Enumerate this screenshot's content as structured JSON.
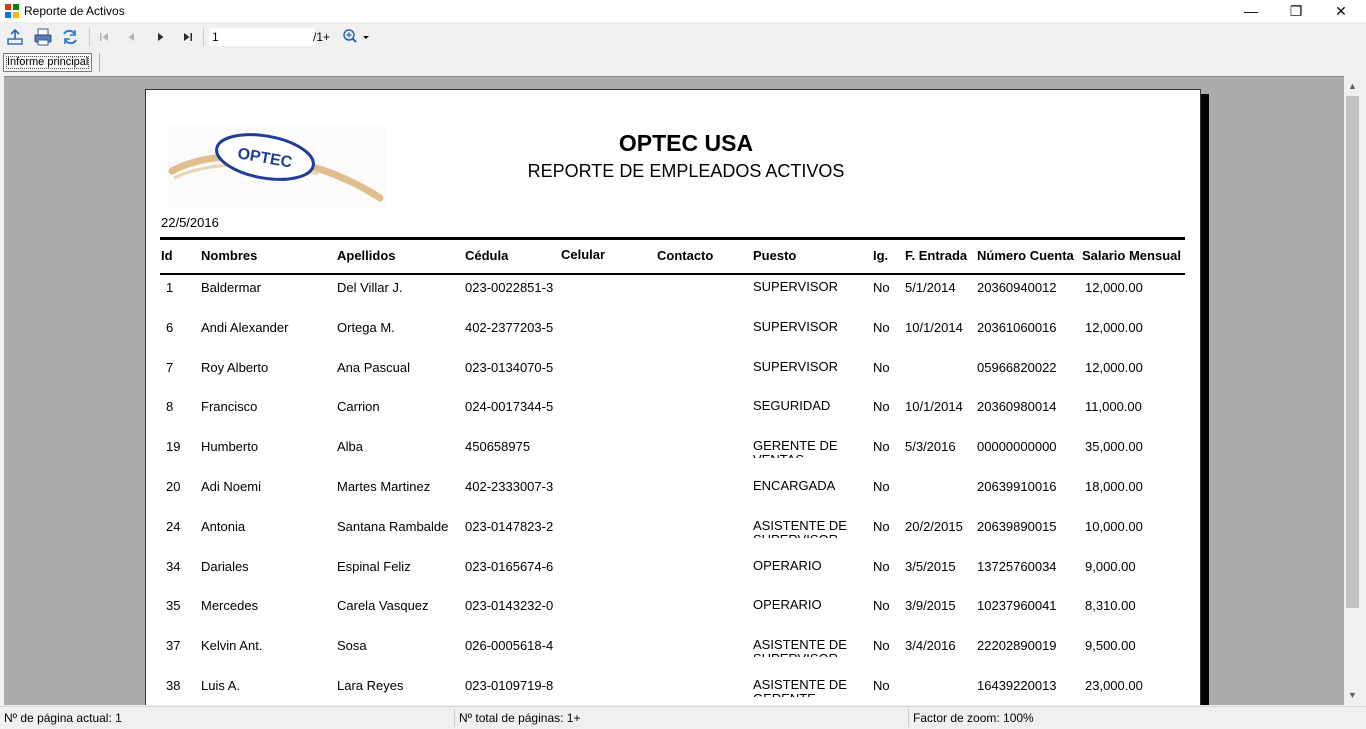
{
  "window": {
    "title": "Reporte de Activos",
    "minimize_glyph": "—",
    "maximize_glyph": "❐",
    "close_glyph": "✕"
  },
  "toolbar": {
    "page_value": "1",
    "page_total": "/1+",
    "icons": [
      "export-icon",
      "print-icon",
      "refresh-icon",
      "first-page-icon",
      "prev-page-icon",
      "next-page-icon",
      "last-page-icon",
      "zoom-icon"
    ]
  },
  "tabs": [
    "Informe principal"
  ],
  "report": {
    "logo_text": "OPTEC",
    "company": "OPTEC USA",
    "title": "REPORTE DE EMPLEADOS ACTIVOS",
    "date": "22/5/2016",
    "columns": [
      "Id",
      "Nombres",
      "Apellidos",
      "Cédula",
      "Celular",
      "Contacto",
      "Puesto",
      "Ig.",
      "F. Entrada",
      "Número Cuenta",
      "Salario Mensual"
    ],
    "rows": [
      {
        "id": "1",
        "nombres": "Baldermar",
        "apellidos": "Del Villar J.",
        "cedula": "023-0022851-3",
        "celular": "",
        "contacto": "",
        "puesto": "SUPERVISOR",
        "ig": "No",
        "entrada": "5/1/2014",
        "cuenta": "20360940012",
        "salario": "12,000.00"
      },
      {
        "id": "6",
        "nombres": "Andi Alexander",
        "apellidos": "Ortega M.",
        "cedula": "402-2377203-5",
        "celular": "",
        "contacto": "",
        "puesto": "SUPERVISOR",
        "ig": "No",
        "entrada": "10/1/2014",
        "cuenta": "20361060016",
        "salario": "12,000.00"
      },
      {
        "id": "7",
        "nombres": "Roy Alberto",
        "apellidos": "Ana Pascual",
        "cedula": "023-0134070-5",
        "celular": "",
        "contacto": "",
        "puesto": "SUPERVISOR",
        "ig": "No",
        "entrada": "",
        "cuenta": "05966820022",
        "salario": "12,000.00"
      },
      {
        "id": "8",
        "nombres": "Francisco",
        "apellidos": "Carrion",
        "cedula": "024-0017344-5",
        "celular": "",
        "contacto": "",
        "puesto": "SEGURIDAD",
        "ig": "No",
        "entrada": "10/1/2014",
        "cuenta": "20360980014",
        "salario": "11,000.00"
      },
      {
        "id": "19",
        "nombres": "Humberto",
        "apellidos": "Alba",
        "cedula": "450658975",
        "celular": "",
        "contacto": "",
        "puesto": "GERENTE DE VENTAS",
        "ig": "No",
        "entrada": "5/3/2016",
        "cuenta": "00000000000",
        "salario": "35,000.00"
      },
      {
        "id": "20",
        "nombres": "Adi Noemi",
        "apellidos": "Martes Martinez",
        "cedula": "402-2333007-3",
        "celular": "",
        "contacto": "",
        "puesto": "ENCARGADA",
        "ig": "No",
        "entrada": "",
        "cuenta": "20639910016",
        "salario": "18,000.00"
      },
      {
        "id": "24",
        "nombres": "Antonia",
        "apellidos": "Santana Rambalde",
        "cedula": "023-0147823-2",
        "celular": "",
        "contacto": "",
        "puesto": "ASISTENTE DE SUPERVISOR",
        "ig": "No",
        "entrada": "20/2/2015",
        "cuenta": "20639890015",
        "salario": "10,000.00"
      },
      {
        "id": "34",
        "nombres": "Dariales",
        "apellidos": "Espinal Feliz",
        "cedula": "023-0165674-6",
        "celular": "",
        "contacto": "",
        "puesto": "OPERARIO",
        "ig": "No",
        "entrada": "3/5/2015",
        "cuenta": "13725760034",
        "salario": "9,000.00"
      },
      {
        "id": "35",
        "nombres": "Mercedes",
        "apellidos": "Carela Vasquez",
        "cedula": "023-0143232-0",
        "celular": "",
        "contacto": "",
        "puesto": "OPERARIO",
        "ig": "No",
        "entrada": "3/9/2015",
        "cuenta": "10237960041",
        "salario": "8,310.00"
      },
      {
        "id": "37",
        "nombres": "Kelvin Ant.",
        "apellidos": "Sosa",
        "cedula": "026-0005618-4",
        "celular": "",
        "contacto": "",
        "puesto": "ASISTENTE DE SUPERVISOR",
        "ig": "No",
        "entrada": "3/4/2016",
        "cuenta": "22202890019",
        "salario": "9,500.00"
      },
      {
        "id": "38",
        "nombres": "Luis A.",
        "apellidos": "Lara Reyes",
        "cedula": "023-0109719-8",
        "celular": "",
        "contacto": "",
        "puesto": "ASISTENTE DE GERENTE",
        "ig": "No",
        "entrada": "",
        "cuenta": "16439220013",
        "salario": "23,000.00"
      }
    ]
  },
  "status": {
    "current_page": "Nº de página actual: 1",
    "total_pages": "Nº total de páginas: 1+",
    "zoom": "Factor de zoom: 100%"
  },
  "colors": {
    "viewer_bg": "#ababab",
    "logo_blue": "#1f3f95",
    "logo_swoosh": "#d9b27a"
  }
}
